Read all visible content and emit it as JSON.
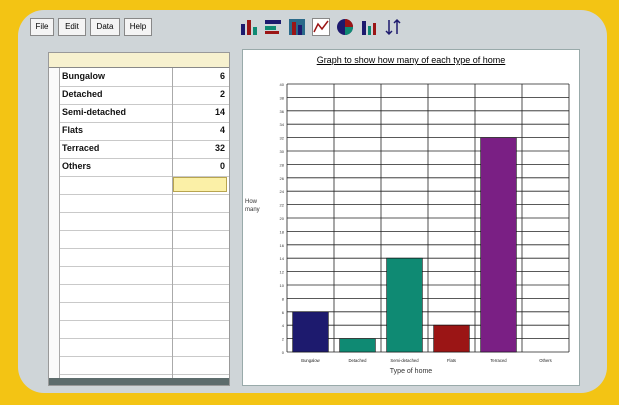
{
  "menu": [
    "File",
    "Edit",
    "Data",
    "Help"
  ],
  "toolbar": {
    "icons": [
      "bar-chart-icon",
      "horizontal-bar-icon",
      "stacked-bar-icon",
      "line-chart-icon",
      "pie-chart-icon",
      "column-chart-icon",
      "sort-icon"
    ]
  },
  "table": {
    "rows": [
      {
        "label": "Bungalow",
        "value": "6"
      },
      {
        "label": "Detached",
        "value": "2"
      },
      {
        "label": "Semi-detached",
        "value": "14"
      },
      {
        "label": "Flats",
        "value": "4"
      },
      {
        "label": "Terraced",
        "value": "32"
      },
      {
        "label": "Others",
        "value": "0"
      }
    ]
  },
  "chart_data": {
    "type": "bar",
    "title": "Graph to show how many of each type of home",
    "xlabel": "Type of home",
    "ylabel": "How many",
    "categories": [
      "Bungalow",
      "Detached",
      "Semi-detached",
      "Flats",
      "Terraced",
      "Others"
    ],
    "values": [
      6,
      2,
      14,
      4,
      32,
      0
    ],
    "ylim": [
      0,
      40
    ],
    "colors": [
      "#1d1a6e",
      "#0f8a73",
      "#0f8a73",
      "#9b1515",
      "#7a1f84",
      "#7a1f84"
    ],
    "grid": true
  }
}
